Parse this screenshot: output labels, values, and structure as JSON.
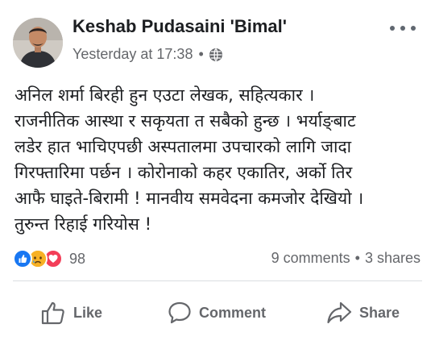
{
  "post": {
    "author": "Keshab Pudasaini 'Bimal'",
    "timestamp": "Yesterday at 17:38",
    "separator": "•",
    "privacy_icon": "globe-icon",
    "more_icon": "more-options-icon",
    "text_lines": [
      "अनिल शर्मा बिरही हुन एउटा लेखक, सहित्यकार ।",
      "राजनीतिक आस्था र सकृयता त सबैको हुन्छ । भर्याङ्बाट",
      "लडेर हात भाचिएपछी अस्पतालमा उपचारको लागि जादा",
      "गिरफ्तारिमा पर्छन । कोरोनाको कहर एकातिर, अर्को तिर",
      "आफै घाइते-बिरामी ! मानवीय समवेदना कमजोर देखियो ।",
      "तुरुन्त रिहाई गरियोस !"
    ]
  },
  "reactions": {
    "icons": [
      "like-reaction-icon",
      "sad-reaction-icon",
      "love-reaction-icon"
    ],
    "count": "98"
  },
  "engagement": {
    "comments": "9 comments",
    "separator": "•",
    "shares": "3 shares"
  },
  "actions": {
    "like": "Like",
    "comment": "Comment",
    "share": "Share"
  },
  "colors": {
    "text": "#1c1e21",
    "secondary": "#65676b",
    "like_blue": "#1877f2",
    "love_red": "#f33e58",
    "sad_yellow": "#f7b125",
    "divider": "#dadde1"
  }
}
